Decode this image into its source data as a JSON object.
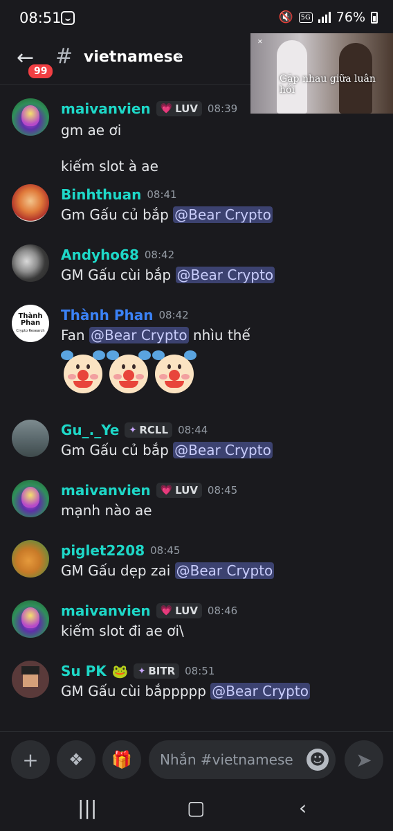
{
  "status_bar": {
    "time": "08:51",
    "network": "5G",
    "battery": "76%"
  },
  "header": {
    "unread_count": "99",
    "channel_name": "vietnamese"
  },
  "pip_video": {
    "title": "Gặp nhau giữa luân hồi"
  },
  "messages": [
    {
      "username": "maivanvien",
      "tag": "LUV",
      "time": "08:39",
      "lines": [
        "gm ae ơi",
        "kiếm slot à ae"
      ]
    },
    {
      "username": "Binhthuan",
      "time": "08:41",
      "text": "Gm Gấu củ bắp",
      "mention": "@Bear Crypto"
    },
    {
      "username": "Andyho68",
      "time": "08:42",
      "text": "GM Gấu cùi bắp",
      "mention": "@Bear Crypto"
    },
    {
      "username": "Thành Phan",
      "time": "08:42",
      "text_before": "Fan",
      "mention": "@Bear Crypto",
      "text_after": "nhìu thế",
      "avatar_text": "Thành Phan",
      "avatar_subtext": "Crypto Research"
    },
    {
      "username": "Gu_._Ye",
      "tag": "RCLL",
      "time": "08:44",
      "text": "Gm Gấu củ bắp",
      "mention": "@Bear Crypto"
    },
    {
      "username": "maivanvien",
      "tag": "LUV",
      "time": "08:45",
      "text": "mạnh nào ae"
    },
    {
      "username": "piglet2208",
      "time": "08:45",
      "text": "GM Gấu dẹp zai",
      "mention": "@Bear Crypto"
    },
    {
      "username": "maivanvien",
      "tag": "LUV",
      "time": "08:46",
      "text": "kiếm slot đi ae ơi\\"
    },
    {
      "username": "Su PK",
      "tag": "BITR",
      "time": "08:51",
      "text": "GM Gấu cùi bắppppp",
      "mention": "@Bear Crypto"
    }
  ],
  "input": {
    "placeholder": "Nhắn #vietnamese"
  },
  "colors": {
    "background": "#1a1a1e",
    "username_teal": "#1ed8c8",
    "username_blue": "#3b82f6",
    "mention_bg": "#3c4270",
    "badge_red": "#f23f43"
  }
}
